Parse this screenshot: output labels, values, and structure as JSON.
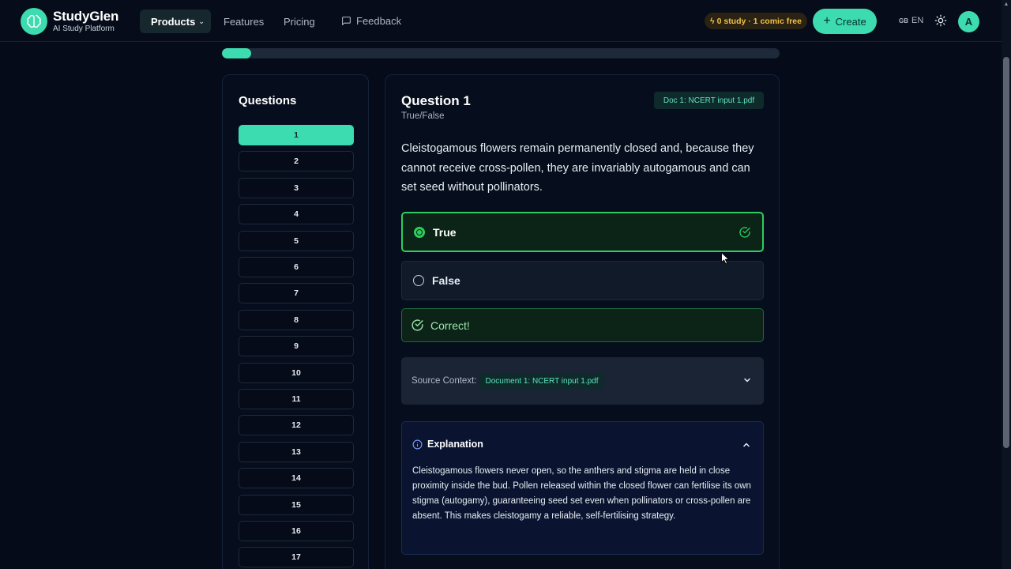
{
  "header": {
    "brand_name": "StudyGlen",
    "brand_tagline": "AI Study Platform",
    "nav": {
      "products": "Products",
      "features": "Features",
      "pricing": "Pricing",
      "feedback": "Feedback"
    },
    "usage_badge": "0 study · 1 comic free",
    "create_label": "Create",
    "lang_flag": "GB",
    "lang_code": "EN",
    "avatar_initial": "A",
    "accent_color": "#3ddbb0"
  },
  "progress": {
    "fraction": 0.053
  },
  "questions_panel": {
    "title": "Questions",
    "active": "1",
    "items": [
      "1",
      "2",
      "3",
      "4",
      "5",
      "6",
      "7",
      "8",
      "9",
      "10",
      "11",
      "12",
      "13",
      "14",
      "15",
      "16",
      "17"
    ]
  },
  "question": {
    "title": "Question 1",
    "type": "True/False",
    "doc_tag": "Doc 1:  NCERT input 1.pdf",
    "text": "Cleistogamous flowers remain permanently closed and, because they cannot receive cross-pollen, they are invariably autogamous and can set seed without pollinators.",
    "options": [
      {
        "label": "True",
        "selected": true,
        "correct": true
      },
      {
        "label": "False",
        "selected": false,
        "correct": false
      }
    ],
    "result": "Correct!",
    "source_label": "Source Context:",
    "source_tag": "Document 1:  NCERT input 1.pdf",
    "explanation_title": "Explanation",
    "explanation_text": "Cleistogamous flowers never open, so the anthers and stigma are held in close proximity inside the bud. Pollen released within the closed flower can fertilise its own stigma (autogamy), guaranteeing seed set even when pollinators or cross-pollen are absent. This makes cleistogamy a reliable, self-fertilising strategy."
  }
}
